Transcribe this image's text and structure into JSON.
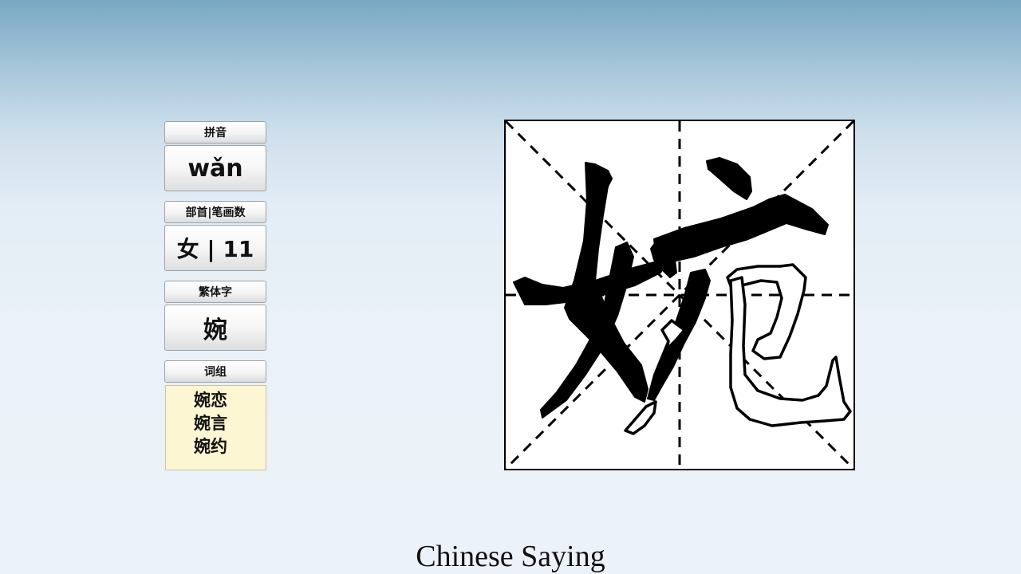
{
  "info_panel": {
    "pinyin_label": "拼音",
    "pinyin_value": "wǎn",
    "radical_label": "部首|笔画数",
    "radical_value": "女 | 11",
    "traditional_label": "繁体字",
    "traditional_value": "婉",
    "words_label": "词组",
    "words": [
      "婉恋",
      "婉言",
      "婉约"
    ]
  },
  "character_display": {
    "character": "婉",
    "grid_line_color": "#000000",
    "filled_stroke_color": "#000000",
    "outline_stroke_color": "#000000"
  },
  "footer": {
    "title": "Chinese Saying"
  }
}
